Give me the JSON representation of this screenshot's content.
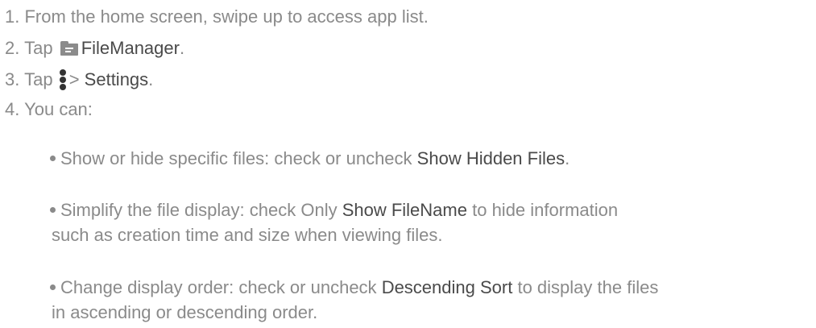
{
  "steps": [
    {
      "number": "1.",
      "text": "From the home screen, swipe up to access app list."
    },
    {
      "number": "2.",
      "pre": "Tap",
      "icon": "folder-icon",
      "bold": "FileManager",
      "post": "."
    },
    {
      "number": "3.",
      "pre": "Tap",
      "icon": "more-vertical-icon",
      "mid": ">",
      "bold": "Settings",
      "post": "."
    },
    {
      "number": "4.",
      "text": "You can:"
    }
  ],
  "bullets": [
    {
      "pre": "Show or hide specific files: check or uncheck",
      "bold": "Show Hidden Files",
      "post": "."
    },
    {
      "pre": "Simplify the file display: check Only",
      "bold": "Show FileName",
      "post": "to hide information",
      "line2": "such as creation time and size when viewing files."
    },
    {
      "pre": "Change display order: check or uncheck",
      "bold": "Descending Sort",
      "post": "to display the files",
      "line2": "in ascending or descending order."
    }
  ]
}
